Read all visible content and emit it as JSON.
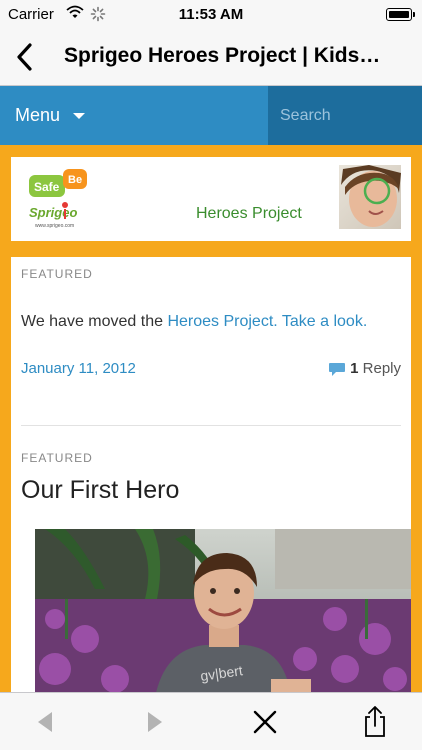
{
  "status_bar": {
    "carrier": "Carrier",
    "time": "11:53 AM"
  },
  "nav": {
    "title": "Sprigeo Heroes Project | Kids…"
  },
  "site_menu": {
    "menu_label": "Menu",
    "search_placeholder": "Search"
  },
  "banner": {
    "logo_safe": "Safe",
    "logo_be": "Be",
    "logo_brand": "Sprigeo",
    "logo_url": "www.sprigeo.com",
    "heroes_text": "Heroes Project"
  },
  "post1": {
    "category": "FEATURED",
    "body_prefix": "We have moved the ",
    "link_text": "Heroes Project. Take a look.",
    "date": "January 11, 2012",
    "reply_count": "1",
    "reply_label": "Reply"
  },
  "post2": {
    "category": "FEATURED",
    "title": "Our First Hero"
  },
  "colors": {
    "accent": "#2e8cc3",
    "page_bg": "#f6a81c",
    "green": "#3a8d2e"
  },
  "icons": {
    "back": "chevron-left-icon",
    "toolbar": [
      "back-arrow-icon",
      "forward-arrow-icon",
      "close-icon",
      "share-icon"
    ]
  }
}
